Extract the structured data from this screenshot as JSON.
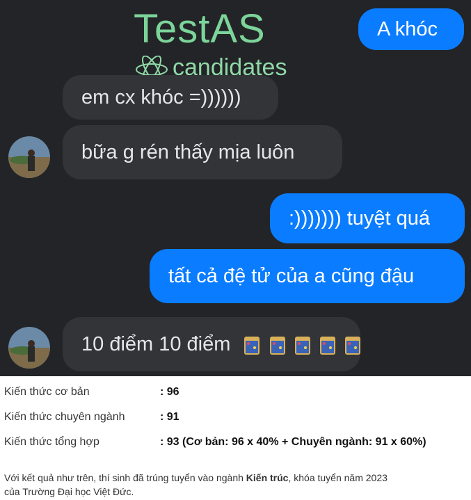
{
  "watermark": {
    "title": "TestAS",
    "subtitle": "candidates"
  },
  "messages": [
    {
      "side": "out",
      "text": "A khóc"
    },
    {
      "side": "in",
      "text": "em cx khóc =))))))"
    },
    {
      "side": "in",
      "text": "bữa g rén thấy mịa luôn"
    },
    {
      "side": "out",
      "text": ":))))))) tuyệt quá"
    },
    {
      "side": "out",
      "text": "tất cả đệ tử của a cũng đậu"
    },
    {
      "side": "in",
      "text": "10 điểm 10 điểm"
    }
  ],
  "results": {
    "rows": [
      {
        "label": "Kiến thức cơ bản",
        "value": ": 96"
      },
      {
        "label": "Kiến thức chuyên ngành",
        "value": ": 91"
      },
      {
        "label": "Kiến thức tổng hợp",
        "value": ": 93 (Cơ bản: 96 x 40% + Chuyên ngành: 91 x 60%)"
      }
    ],
    "note_prefix": "Với kết quả như trên, thí sinh đã trúng tuyển vào ngành ",
    "note_major": "Kiến trúc",
    "note_suffix": ", khóa tuyển năm 2023",
    "note_line2": "của Trường Đại học Việt Đức."
  },
  "colors": {
    "chat_bg": "#232427",
    "outgoing": "#0a7cff",
    "incoming": "#333437",
    "watermark": "#7cd49a"
  }
}
